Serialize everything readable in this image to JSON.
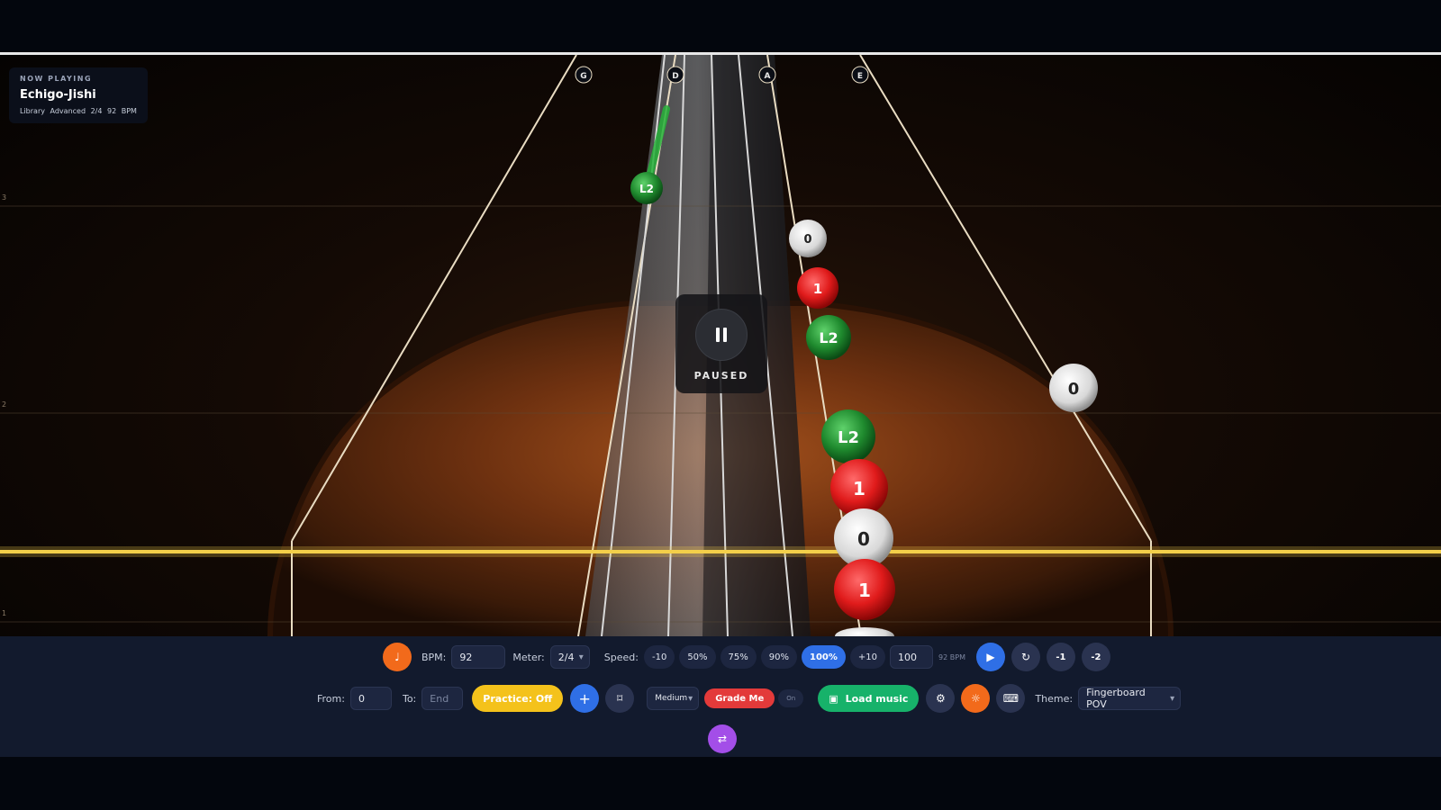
{
  "now_playing": {
    "label": "NOW PLAYING",
    "title": "Echigo-Jishi",
    "meta": "Library Advanced 2/4 92 BPM"
  },
  "strings": [
    "G",
    "D",
    "A",
    "E"
  ],
  "row_labels": [
    "3",
    "2",
    "1"
  ],
  "notes": [
    {
      "label": "L2",
      "color": "green"
    },
    {
      "label": "0",
      "color": "white"
    },
    {
      "label": "1",
      "color": "red"
    },
    {
      "label": "L2",
      "color": "green"
    },
    {
      "label": "0",
      "color": "white"
    },
    {
      "label": "L2",
      "color": "green"
    },
    {
      "label": "1",
      "color": "red"
    },
    {
      "label": "0",
      "color": "white"
    },
    {
      "label": "1",
      "color": "red"
    }
  ],
  "pause_overlay": {
    "status": "PAUSED"
  },
  "colors": {
    "accent_blue": "#2f6fe6",
    "target_line": "#f3cf4a",
    "note_green": "#1f8a2e",
    "note_red": "#e01b1b",
    "note_white": "#e6e6e6"
  },
  "toolbar1": {
    "bpm_label": "BPM:",
    "bpm_value": "92",
    "meter_label": "Meter:",
    "meter_value": "2/4",
    "speed_label": "Speed:",
    "speed_chips": [
      "-10",
      "50%",
      "75%",
      "90%",
      "100%",
      "+10"
    ],
    "speed_active": "100%",
    "speed_value": "100",
    "bpm_readout": "92 BPM",
    "step_back_1": "-1",
    "step_back_2": "-2"
  },
  "toolbar2": {
    "from_label": "From:",
    "from_value": "0",
    "to_label": "To:",
    "to_placeholder": "End",
    "practice_label": "Practice: Off",
    "difficulty_value": "Medium",
    "grade_label": "Grade Me",
    "toggle_label": "On",
    "load_label": "Load music",
    "theme_label": "Theme:",
    "theme_value": "Fingerboard POV"
  }
}
